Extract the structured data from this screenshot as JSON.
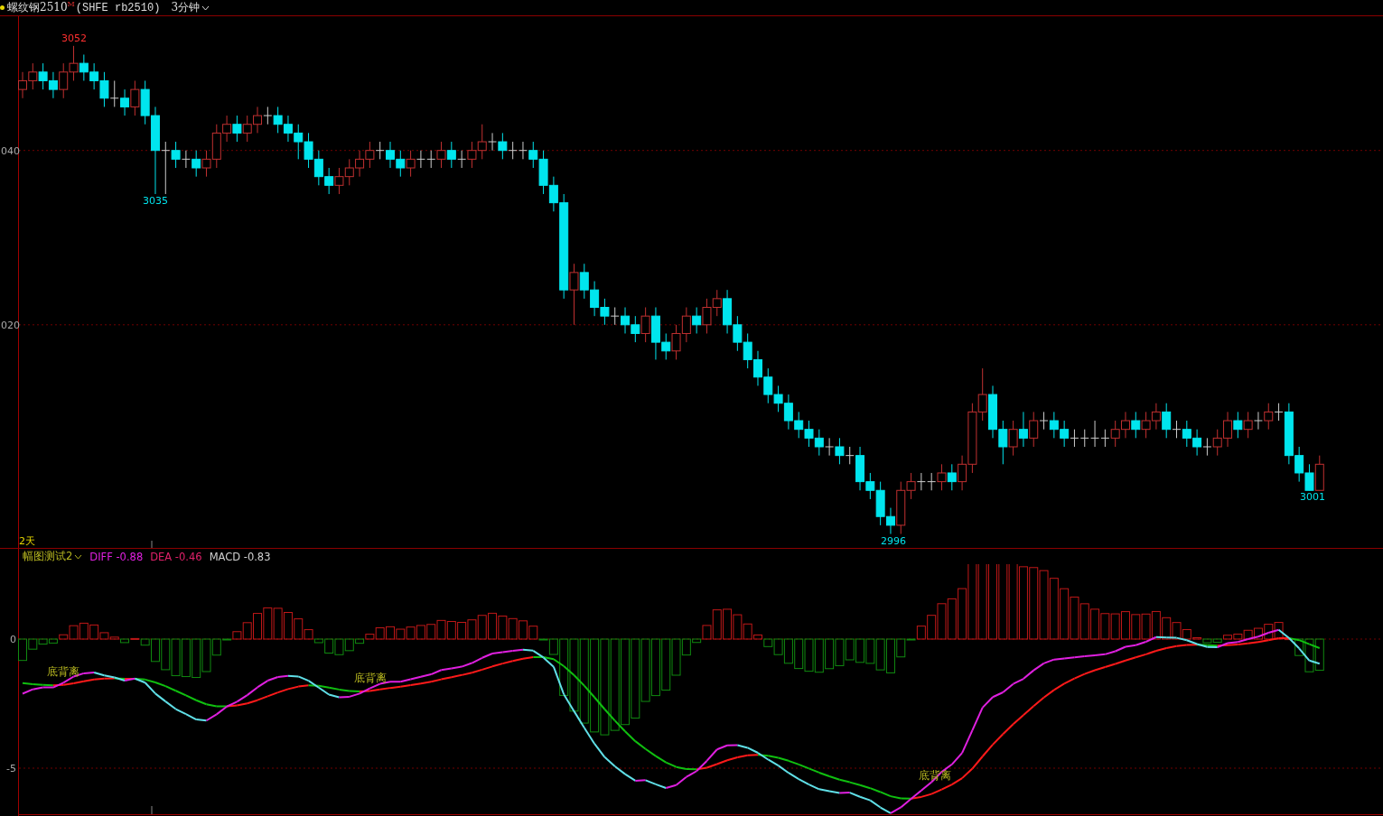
{
  "header": {
    "title": "螺纹钢2510",
    "mark": "M",
    "code": "(SHFE rb2510)",
    "period": "3分钟"
  },
  "price_chart": {
    "chart_data": {
      "type": "candlestick",
      "ylim": [
        -5.6,
        55.4
      ],
      "yticks": [
        {
          "value": 40,
          "label": "040"
        },
        {
          "value": 20,
          "label": "020"
        }
      ],
      "categories": [
        null,
        null,
        null,
        null,
        null,
        null,
        null,
        null,
        null,
        null,
        null,
        null,
        null,
        null,
        null,
        null,
        null,
        null,
        null,
        null,
        null,
        null,
        null,
        null,
        null,
        null,
        null,
        null,
        null,
        null,
        null,
        null,
        null,
        null,
        null,
        null,
        null,
        null,
        null,
        null,
        null,
        null,
        null,
        null,
        null,
        null,
        null,
        null,
        null,
        null,
        null,
        null,
        null,
        null,
        null,
        null,
        null,
        null,
        null,
        null,
        null,
        null,
        null,
        null,
        null,
        null,
        null,
        null,
        null,
        null,
        null,
        null,
        null,
        null,
        null,
        null,
        null,
        null,
        null,
        null,
        null,
        null,
        null,
        null,
        null,
        null,
        null,
        null,
        null,
        null,
        null,
        null,
        null,
        null,
        null,
        null,
        null,
        null,
        null,
        null,
        null,
        null,
        null,
        null,
        null,
        null,
        null,
        null,
        null,
        null,
        null,
        null,
        null,
        null,
        null,
        null,
        null,
        null,
        null,
        null,
        null,
        null,
        null,
        null,
        null,
        null,
        null,
        null
      ],
      "ohlc": [
        [
          47,
          49,
          46,
          48
        ],
        [
          48,
          50,
          47,
          49
        ],
        [
          49,
          50,
          47,
          48
        ],
        [
          48,
          49,
          46,
          47
        ],
        [
          47,
          50,
          46,
          49
        ],
        [
          49,
          52,
          48,
          50
        ],
        [
          50,
          51,
          48,
          49
        ],
        [
          49,
          50,
          47,
          48
        ],
        [
          48,
          49,
          45,
          46
        ],
        [
          46,
          48,
          45,
          46
        ],
        [
          46,
          47,
          44,
          45
        ],
        [
          45,
          48,
          44,
          47
        ],
        [
          47,
          48,
          43,
          44
        ],
        [
          44,
          45,
          35,
          40
        ],
        [
          40,
          41,
          35,
          40
        ],
        [
          40,
          41,
          38,
          39
        ],
        [
          39,
          40,
          38,
          39
        ],
        [
          39,
          40,
          37,
          38
        ],
        [
          38,
          40,
          37,
          39
        ],
        [
          39,
          43,
          38,
          42
        ],
        [
          42,
          44,
          41,
          43
        ],
        [
          43,
          44,
          41,
          42
        ],
        [
          42,
          44,
          41,
          43
        ],
        [
          43,
          45,
          42,
          44
        ],
        [
          44,
          45,
          43,
          44
        ],
        [
          44,
          45,
          42,
          43
        ],
        [
          43,
          44,
          41,
          42
        ],
        [
          42,
          43,
          39,
          41
        ],
        [
          41,
          42,
          38,
          39
        ],
        [
          39,
          40,
          36,
          37
        ],
        [
          37,
          38,
          35,
          36
        ],
        [
          36,
          38,
          35,
          37
        ],
        [
          37,
          39,
          36,
          38
        ],
        [
          38,
          40,
          37,
          39
        ],
        [
          39,
          41,
          38,
          40
        ],
        [
          40,
          41,
          39,
          40
        ],
        [
          40,
          41,
          38,
          39
        ],
        [
          39,
          40,
          37,
          38
        ],
        [
          38,
          40,
          37,
          39
        ],
        [
          39,
          40,
          38,
          39
        ],
        [
          39,
          40,
          38,
          39
        ],
        [
          39,
          41,
          38,
          40
        ],
        [
          40,
          41,
          38,
          39
        ],
        [
          39,
          40,
          38,
          39
        ],
        [
          39,
          41,
          38,
          40
        ],
        [
          40,
          43,
          39,
          41
        ],
        [
          41,
          42,
          40,
          41
        ],
        [
          41,
          42,
          39,
          40
        ],
        [
          40,
          41,
          39,
          40
        ],
        [
          40,
          41,
          39,
          40
        ],
        [
          40,
          41,
          38,
          39
        ],
        [
          39,
          40,
          35,
          36
        ],
        [
          36,
          37,
          33,
          34
        ],
        [
          34,
          35,
          23,
          24
        ],
        [
          24,
          27,
          20,
          26
        ],
        [
          26,
          27,
          23,
          24
        ],
        [
          24,
          25,
          21,
          22
        ],
        [
          22,
          23,
          20,
          21
        ],
        [
          21,
          22,
          20,
          21
        ],
        [
          21,
          22,
          19,
          20
        ],
        [
          20,
          21,
          18,
          19
        ],
        [
          19,
          22,
          18,
          21
        ],
        [
          21,
          22,
          16,
          18
        ],
        [
          18,
          19,
          16,
          17
        ],
        [
          17,
          20,
          16,
          19
        ],
        [
          19,
          22,
          18,
          21
        ],
        [
          21,
          22,
          19,
          20
        ],
        [
          20,
          23,
          19,
          22
        ],
        [
          22,
          24,
          21,
          23
        ],
        [
          23,
          24,
          19,
          20
        ],
        [
          20,
          21,
          17,
          18
        ],
        [
          18,
          19,
          15,
          16
        ],
        [
          16,
          17,
          13,
          14
        ],
        [
          14,
          15,
          11,
          12
        ],
        [
          12,
          13,
          10,
          11
        ],
        [
          11,
          12,
          8,
          9
        ],
        [
          9,
          10,
          7,
          8
        ],
        [
          8,
          9,
          6,
          7
        ],
        [
          7,
          8,
          5,
          6
        ],
        [
          6,
          7,
          5,
          6
        ],
        [
          6,
          7,
          4,
          5
        ],
        [
          5,
          6,
          4,
          5
        ],
        [
          5,
          6,
          1,
          2
        ],
        [
          2,
          3,
          0,
          1
        ],
        [
          1,
          2,
          -3,
          -2
        ],
        [
          -2,
          -1,
          -4,
          -3
        ],
        [
          -3,
          2,
          -4,
          1
        ],
        [
          1,
          3,
          0,
          2
        ],
        [
          2,
          3,
          1,
          2
        ],
        [
          2,
          3,
          1,
          2
        ],
        [
          2,
          4,
          1,
          3
        ],
        [
          3,
          4,
          1,
          2
        ],
        [
          2,
          5,
          1,
          4
        ],
        [
          4,
          11,
          3,
          10
        ],
        [
          10,
          15,
          9,
          12
        ],
        [
          12,
          13,
          7,
          8
        ],
        [
          8,
          9,
          4,
          6
        ],
        [
          6,
          9,
          5,
          8
        ],
        [
          8,
          10,
          6,
          7
        ],
        [
          7,
          10,
          6,
          9
        ],
        [
          9,
          10,
          8,
          9
        ],
        [
          9,
          10,
          7,
          8
        ],
        [
          8,
          9,
          6,
          7
        ],
        [
          7,
          8,
          6,
          7
        ],
        [
          7,
          8,
          6,
          7
        ],
        [
          7,
          9,
          6,
          7
        ],
        [
          7,
          8,
          6,
          7
        ],
        [
          7,
          9,
          6,
          8
        ],
        [
          8,
          10,
          7,
          9
        ],
        [
          9,
          10,
          7,
          8
        ],
        [
          8,
          10,
          7,
          9
        ],
        [
          9,
          11,
          8,
          10
        ],
        [
          10,
          11,
          7,
          8
        ],
        [
          8,
          9,
          7,
          8
        ],
        [
          8,
          9,
          6,
          7
        ],
        [
          7,
          8,
          5,
          6
        ],
        [
          6,
          7,
          5,
          6
        ],
        [
          6,
          8,
          5,
          7
        ],
        [
          7,
          10,
          6,
          9
        ],
        [
          9,
          10,
          7,
          8
        ],
        [
          8,
          10,
          7,
          9
        ],
        [
          9,
          10,
          8,
          9
        ],
        [
          9,
          11,
          8,
          10
        ],
        [
          10,
          11,
          9,
          10
        ],
        [
          10,
          11,
          4,
          5
        ],
        [
          5,
          6,
          2,
          3
        ],
        [
          3,
          4,
          1,
          1
        ],
        [
          1,
          5,
          1,
          4
        ]
      ]
    },
    "price_labels": [
      {
        "text": "3052",
        "kind": "high"
      },
      {
        "text": "3035",
        "kind": "low"
      },
      {
        "text": "2996",
        "kind": "low"
      },
      {
        "text": "3001",
        "kind": "low"
      }
    ],
    "span_label": "2天"
  },
  "indicator": {
    "name": "幅图测试2",
    "values": [
      {
        "label": "DIFF -0.88",
        "color": "#e020e0"
      },
      {
        "label": "DEA -0.46",
        "color": "#e0206a"
      },
      {
        "label": "MACD -0.83",
        "color": "#d0d0d0"
      }
    ],
    "axis_labels": [
      "0",
      "-5"
    ],
    "annotations": [
      "底背离",
      "底背离",
      "底背离"
    ]
  }
}
